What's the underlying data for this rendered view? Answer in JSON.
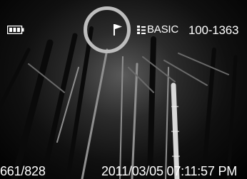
{
  "screen": {
    "quality_label": "BASIC",
    "file_number": "100-1363",
    "frame_counter": "661/828",
    "datetime": "2011/03/05 07:11:57 PM"
  },
  "icons": {
    "battery": "battery-full-icon",
    "flag": "flag-icon",
    "quality": "quality-grid-icon"
  },
  "colors": {
    "osd_text": "#ffffff",
    "highlight_ring": "#bdbdbd"
  }
}
